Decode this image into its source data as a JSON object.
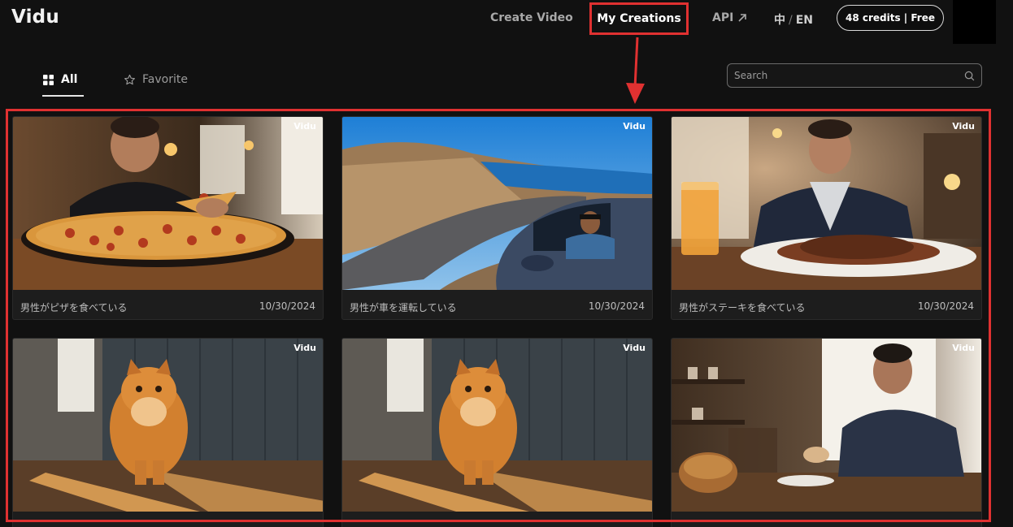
{
  "header": {
    "logo": "Vidu",
    "nav": {
      "create_video": "Create Video",
      "my_creations": "My Creations",
      "api": "API",
      "lang_zh": "中",
      "lang_sep": "/",
      "lang_en": "EN"
    },
    "credits": "48 credits | Free"
  },
  "filters": {
    "all": "All",
    "favorite": "Favorite"
  },
  "search": {
    "placeholder": "Search"
  },
  "cards": [
    {
      "caption": "男性がピザを食べている",
      "date": "10/30/2024",
      "watermark": "Vidu"
    },
    {
      "caption": "男性が車を運転している",
      "date": "10/30/2024",
      "watermark": "Vidu"
    },
    {
      "caption": "男性がステーキを食べている",
      "date": "10/30/2024",
      "watermark": "Vidu"
    },
    {
      "caption": "",
      "date": "",
      "watermark": "Vidu"
    },
    {
      "caption": "",
      "date": "",
      "watermark": "Vidu"
    },
    {
      "caption": "",
      "date": "",
      "watermark": "Vidu"
    }
  ],
  "colors": {
    "background": "#111111",
    "highlight": "#e03131",
    "card": "#1d1d1d"
  },
  "icons": {
    "api": "arrow-up-right-icon",
    "all": "grid-icon",
    "favorite": "star-icon",
    "search": "search-icon"
  }
}
